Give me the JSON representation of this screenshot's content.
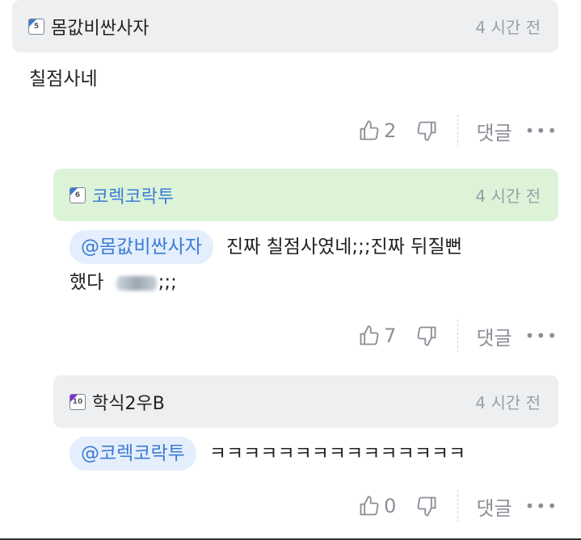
{
  "comments": [
    {
      "level": "5",
      "level_color": "#3a7bd5",
      "nickname": "몸값비싼사자",
      "time": "4 시간 전",
      "text": "칠점사네",
      "likes": "2",
      "reply_label": "댓글",
      "more": "•••"
    },
    {
      "level": "6",
      "level_color": "#3a7bd5",
      "nickname": "코렉코락투",
      "time": "4 시간 전",
      "mention": "@몸값비싼사자",
      "text_line1": "진짜 칠점사였네;;;진짜 뒤질뻔",
      "text_line2_a": "했다 ",
      "text_line2_b": ";;;",
      "likes": "7",
      "reply_label": "댓글",
      "more": "•••"
    },
    {
      "level": "10",
      "level_color": "#7a2fd0",
      "nickname": "학식2우B",
      "time": "4 시간 전",
      "mention": "@코렉코락투",
      "text": "ㅋㅋㅋㅋㅋㅋㅋㅋㅋㅋㅋㅋㅋㅋㅋ",
      "likes": "0",
      "reply_label": "댓글",
      "more": "•••"
    }
  ],
  "icons": [
    "thumbs-up-icon",
    "thumbs-down-icon",
    "level-badge-icon",
    "more-icon"
  ]
}
